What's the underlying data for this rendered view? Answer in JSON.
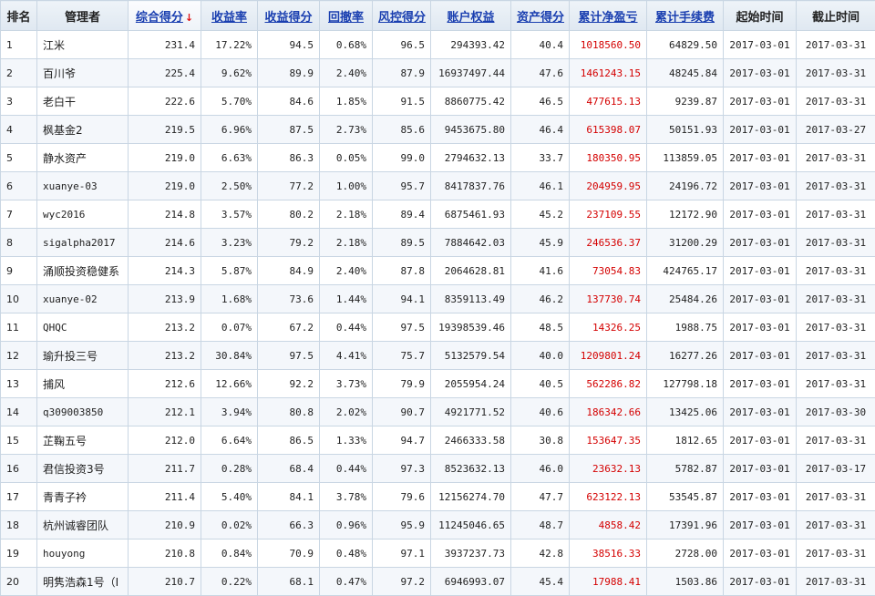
{
  "headers": {
    "rank": "排名",
    "manager": "管理者",
    "score": "综合得分",
    "score_arrow": "↓",
    "return": "收益率",
    "return_score": "收益得分",
    "drawdown": "回撤率",
    "risk_score": "风控得分",
    "equity": "账户权益",
    "asset_score": "资产得分",
    "net_pnl": "累计净盈亏",
    "fees": "累计手续费",
    "start": "起始时间",
    "end": "截止时间"
  },
  "rows": [
    {
      "rank": "1",
      "manager": "江米",
      "score": "231.4",
      "ret": "17.22%",
      "ret_score": "94.5",
      "dd": "0.68%",
      "risk": "96.5",
      "equity": "294393.42",
      "asset": "40.4",
      "pnl": "1018560.50",
      "fees": "64829.50",
      "start": "2017-03-01",
      "end": "2017-03-31"
    },
    {
      "rank": "2",
      "manager": "百川爷",
      "score": "225.4",
      "ret": "9.62%",
      "ret_score": "89.9",
      "dd": "2.40%",
      "risk": "87.9",
      "equity": "16937497.44",
      "asset": "47.6",
      "pnl": "1461243.15",
      "fees": "48245.84",
      "start": "2017-03-01",
      "end": "2017-03-31"
    },
    {
      "rank": "3",
      "manager": "老白干",
      "score": "222.6",
      "ret": "5.70%",
      "ret_score": "84.6",
      "dd": "1.85%",
      "risk": "91.5",
      "equity": "8860775.42",
      "asset": "46.5",
      "pnl": "477615.13",
      "fees": "9239.87",
      "start": "2017-03-01",
      "end": "2017-03-31"
    },
    {
      "rank": "4",
      "manager": "枫基金2",
      "score": "219.5",
      "ret": "6.96%",
      "ret_score": "87.5",
      "dd": "2.73%",
      "risk": "85.6",
      "equity": "9453675.80",
      "asset": "46.4",
      "pnl": "615398.07",
      "fees": "50151.93",
      "start": "2017-03-01",
      "end": "2017-03-27"
    },
    {
      "rank": "5",
      "manager": "静水资产",
      "score": "219.0",
      "ret": "6.63%",
      "ret_score": "86.3",
      "dd": "0.05%",
      "risk": "99.0",
      "equity": "2794632.13",
      "asset": "33.7",
      "pnl": "180350.95",
      "fees": "113859.05",
      "start": "2017-03-01",
      "end": "2017-03-31"
    },
    {
      "rank": "6",
      "manager": "xuanye-03",
      "score": "219.0",
      "ret": "2.50%",
      "ret_score": "77.2",
      "dd": "1.00%",
      "risk": "95.7",
      "equity": "8417837.76",
      "asset": "46.1",
      "pnl": "204959.95",
      "fees": "24196.72",
      "start": "2017-03-01",
      "end": "2017-03-31"
    },
    {
      "rank": "7",
      "manager": "wyc2016",
      "score": "214.8",
      "ret": "3.57%",
      "ret_score": "80.2",
      "dd": "2.18%",
      "risk": "89.4",
      "equity": "6875461.93",
      "asset": "45.2",
      "pnl": "237109.55",
      "fees": "12172.90",
      "start": "2017-03-01",
      "end": "2017-03-31"
    },
    {
      "rank": "8",
      "manager": "sigalpha2017",
      "score": "214.6",
      "ret": "3.23%",
      "ret_score": "79.2",
      "dd": "2.18%",
      "risk": "89.5",
      "equity": "7884642.03",
      "asset": "45.9",
      "pnl": "246536.37",
      "fees": "31200.29",
      "start": "2017-03-01",
      "end": "2017-03-31"
    },
    {
      "rank": "9",
      "manager": "涌顺投资稳健系",
      "score": "214.3",
      "ret": "5.87%",
      "ret_score": "84.9",
      "dd": "2.40%",
      "risk": "87.8",
      "equity": "2064628.81",
      "asset": "41.6",
      "pnl": "73054.83",
      "fees": "424765.17",
      "start": "2017-03-01",
      "end": "2017-03-31"
    },
    {
      "rank": "10",
      "manager": "xuanye-02",
      "score": "213.9",
      "ret": "1.68%",
      "ret_score": "73.6",
      "dd": "1.44%",
      "risk": "94.1",
      "equity": "8359113.49",
      "asset": "46.2",
      "pnl": "137730.74",
      "fees": "25484.26",
      "start": "2017-03-01",
      "end": "2017-03-31"
    },
    {
      "rank": "11",
      "manager": "QHQC",
      "score": "213.2",
      "ret": "0.07%",
      "ret_score": "67.2",
      "dd": "0.44%",
      "risk": "97.5",
      "equity": "19398539.46",
      "asset": "48.5",
      "pnl": "14326.25",
      "fees": "1988.75",
      "start": "2017-03-01",
      "end": "2017-03-31"
    },
    {
      "rank": "12",
      "manager": "瑜升投三号",
      "score": "213.2",
      "ret": "30.84%",
      "ret_score": "97.5",
      "dd": "4.41%",
      "risk": "75.7",
      "equity": "5132579.54",
      "asset": "40.0",
      "pnl": "1209801.24",
      "fees": "16277.26",
      "start": "2017-03-01",
      "end": "2017-03-31"
    },
    {
      "rank": "13",
      "manager": "捕风",
      "score": "212.6",
      "ret": "12.66%",
      "ret_score": "92.2",
      "dd": "3.73%",
      "risk": "79.9",
      "equity": "2055954.24",
      "asset": "40.5",
      "pnl": "562286.82",
      "fees": "127798.18",
      "start": "2017-03-01",
      "end": "2017-03-31"
    },
    {
      "rank": "14",
      "manager": "q309003850",
      "score": "212.1",
      "ret": "3.94%",
      "ret_score": "80.8",
      "dd": "2.02%",
      "risk": "90.7",
      "equity": "4921771.52",
      "asset": "40.6",
      "pnl": "186342.66",
      "fees": "13425.06",
      "start": "2017-03-01",
      "end": "2017-03-30"
    },
    {
      "rank": "15",
      "manager": "芷鞠五号",
      "score": "212.0",
      "ret": "6.64%",
      "ret_score": "86.5",
      "dd": "1.33%",
      "risk": "94.7",
      "equity": "2466333.58",
      "asset": "30.8",
      "pnl": "153647.35",
      "fees": "1812.65",
      "start": "2017-03-01",
      "end": "2017-03-31"
    },
    {
      "rank": "16",
      "manager": "君信投资3号",
      "score": "211.7",
      "ret": "0.28%",
      "ret_score": "68.4",
      "dd": "0.44%",
      "risk": "97.3",
      "equity": "8523632.13",
      "asset": "46.0",
      "pnl": "23632.13",
      "fees": "5782.87",
      "start": "2017-03-01",
      "end": "2017-03-17"
    },
    {
      "rank": "17",
      "manager": "青青子衿",
      "score": "211.4",
      "ret": "5.40%",
      "ret_score": "84.1",
      "dd": "3.78%",
      "risk": "79.6",
      "equity": "12156274.70",
      "asset": "47.7",
      "pnl": "623122.13",
      "fees": "53545.87",
      "start": "2017-03-01",
      "end": "2017-03-31"
    },
    {
      "rank": "18",
      "manager": "杭州诚睿团队",
      "score": "210.9",
      "ret": "0.02%",
      "ret_score": "66.3",
      "dd": "0.96%",
      "risk": "95.9",
      "equity": "11245046.65",
      "asset": "48.7",
      "pnl": "4858.42",
      "fees": "17391.96",
      "start": "2017-03-01",
      "end": "2017-03-31"
    },
    {
      "rank": "19",
      "manager": "houyong",
      "score": "210.8",
      "ret": "0.84%",
      "ret_score": "70.9",
      "dd": "0.48%",
      "risk": "97.1",
      "equity": "3937237.73",
      "asset": "42.8",
      "pnl": "38516.33",
      "fees": "2728.00",
      "start": "2017-03-01",
      "end": "2017-03-31"
    },
    {
      "rank": "20",
      "manager": "明隽浩森1号（Ⅰ",
      "score": "210.7",
      "ret": "0.22%",
      "ret_score": "68.1",
      "dd": "0.47%",
      "risk": "97.2",
      "equity": "6946993.07",
      "asset": "45.4",
      "pnl": "17988.41",
      "fees": "1503.86",
      "start": "2017-03-01",
      "end": "2017-03-31"
    }
  ],
  "colors": {
    "header_link": "#1a3fb0",
    "pnl_positive": "#d40000",
    "sort_arrow": "#e01010",
    "border": "#c9d6e3"
  }
}
